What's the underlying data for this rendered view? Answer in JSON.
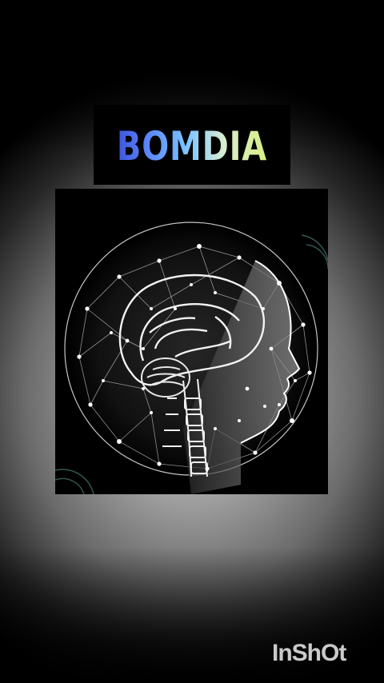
{
  "title": {
    "text": "BOMDIA",
    "gradient_colors": [
      "#3a4fd6",
      "#5a86ff",
      "#7fc7ff",
      "#d9ecd3",
      "#d8f07a"
    ]
  },
  "image": {
    "icon": "ai-brain-network-head-illustration"
  },
  "watermark": {
    "text": "InShOt"
  }
}
